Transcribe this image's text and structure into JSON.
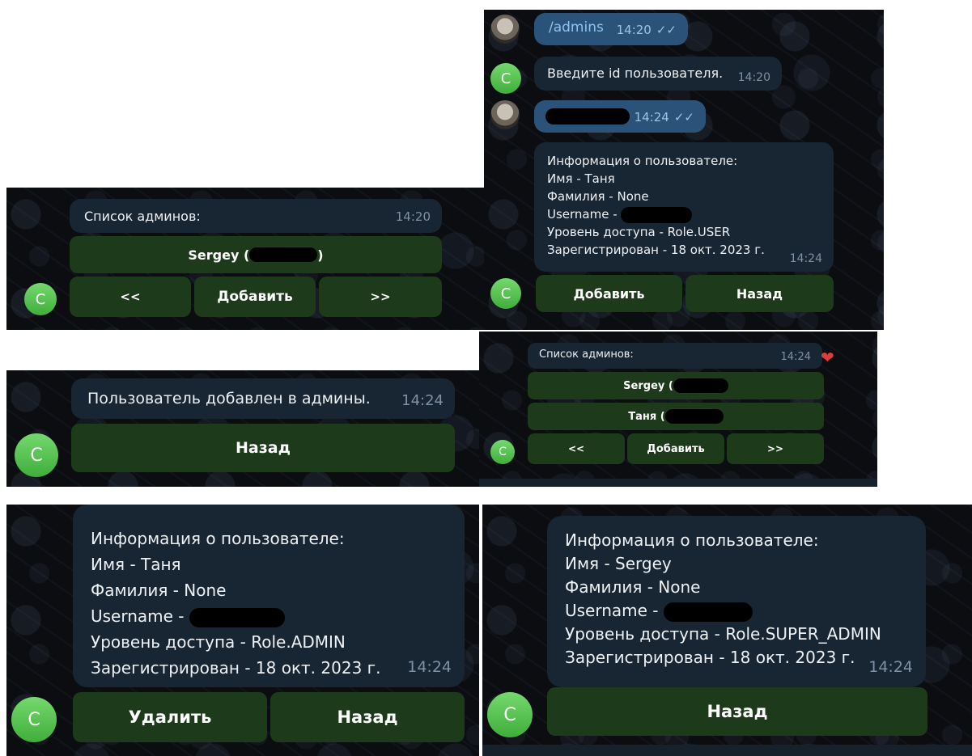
{
  "panel_a": {
    "cmd_text": "/admins",
    "cmd_time": "14:20",
    "cmd_ticks": "✓✓",
    "prompt_text": "Введите id пользователя.",
    "prompt_time": "14:20",
    "id_time": "14:24",
    "id_ticks": "✓✓",
    "info_lines": [
      "Информация о пользователе:",
      "Имя - Таня",
      "Фамилия - None",
      "Username -",
      "Уровень доступа - Role.USER",
      "Зарегистрирован - 18 окт. 2023 г."
    ],
    "info_time": "14:24",
    "btn_add": "Добавить",
    "btn_back": "Назад",
    "avatar_letter": "C"
  },
  "panel_b": {
    "title": "Список админов:",
    "time": "14:20",
    "admin_1": "Sergey (",
    "admin_1_close": ")",
    "btn_prev": "<<",
    "btn_add": "Добавить",
    "btn_next": ">>",
    "avatar_letter": "C"
  },
  "panel_c": {
    "title": "Список админов:",
    "time": "14:24",
    "reaction": "❤",
    "admin_1": "Sergey (",
    "admin_2": "Таня (",
    "btn_prev": "<<",
    "btn_add": "Добавить",
    "btn_next": ">>",
    "avatar_letter": "C"
  },
  "panel_d": {
    "text": "Пользователь добавлен в админы.",
    "time": "14:24",
    "btn_back": "Назад",
    "avatar_letter": "C"
  },
  "panel_e": {
    "info_lines": [
      "Информация о пользователе:",
      "Имя - Таня",
      "Фамилия - None",
      "Username -",
      "Уровень доступа - Role.ADMIN",
      "Зарегистрирован - 18 окт. 2023 г."
    ],
    "time": "14:24",
    "btn_delete": "Удалить",
    "btn_back": "Назад",
    "avatar_letter": "C"
  },
  "panel_f": {
    "info_lines": [
      "Информация о пользователе:",
      "Имя - Sergey",
      "Фамилия - None",
      "Username -",
      "Уровень доступа - Role.SUPER_ADMIN",
      "Зарегистрирован - 18 окт. 2023 г."
    ],
    "time": "14:24",
    "btn_back": "Назад",
    "avatar_letter": "C"
  }
}
